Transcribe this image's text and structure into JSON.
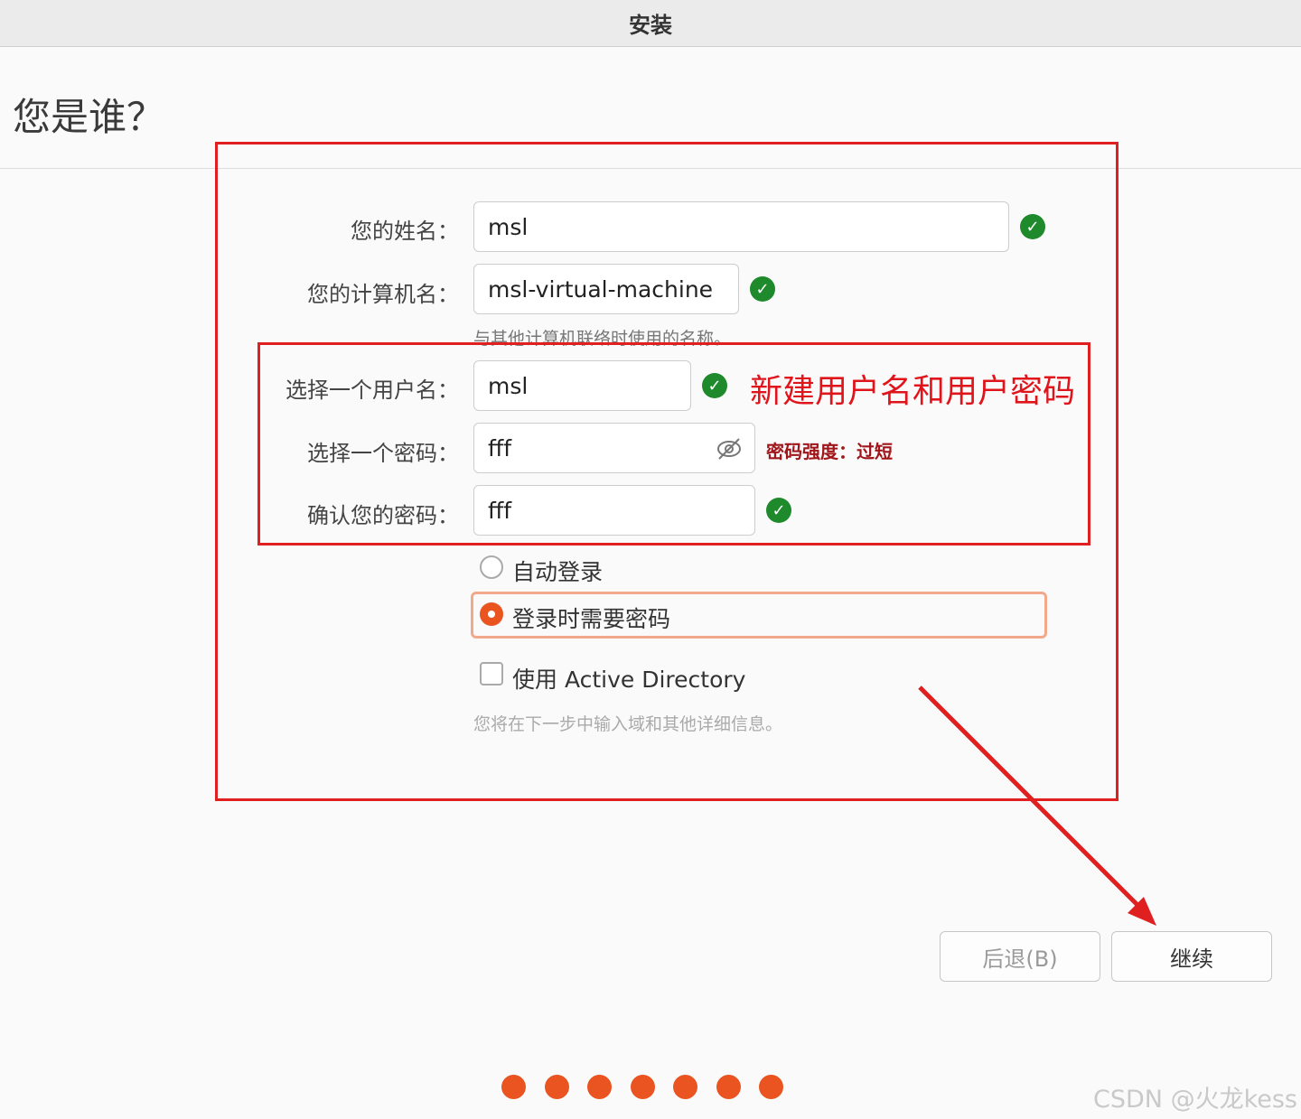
{
  "window": {
    "title": "安装"
  },
  "page": {
    "heading": "您是谁？"
  },
  "form": {
    "name_label": "您的姓名：",
    "name_value": "msl",
    "computer_label": "您的计算机名：",
    "computer_value": "msl-virtual-machine",
    "computer_hint": "与其他计算机联络时使用的名称。",
    "username_label": "选择一个用户名：",
    "username_value": "msl",
    "password_label": "选择一个密码：",
    "password_value": "fff",
    "password_strength": "密码强度：过短",
    "confirm_label": "确认您的密码：",
    "confirm_value": "fff",
    "auto_login_label": "自动登录",
    "require_password_label": "登录时需要密码",
    "login_mode": "require_password",
    "active_directory_label": "使用 Active Directory",
    "active_directory_checked": false,
    "active_directory_hint": "您将在下一步中输入域和其他详细信息。"
  },
  "annotation": {
    "text": "新建用户名和用户密码",
    "color": "#e0151c"
  },
  "buttons": {
    "back_label": "后退(B)",
    "continue_label": "继续"
  },
  "progress": {
    "total_steps": 7
  },
  "watermark": "CSDN @火龙kess",
  "colors": {
    "accent": "#e95420",
    "valid": "#1e8a2b",
    "annotation": "#e02020"
  }
}
